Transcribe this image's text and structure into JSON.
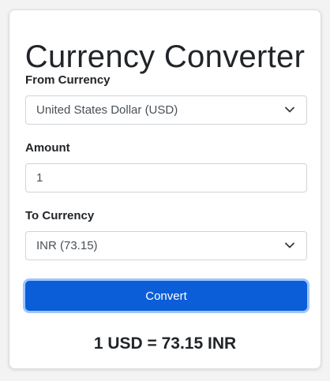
{
  "app": {
    "title": "Currency Converter"
  },
  "form": {
    "from_label": "From Currency",
    "from_value": "United States Dollar (USD)",
    "amount_label": "Amount",
    "amount_value": "1",
    "to_label": "To Currency",
    "to_value": "INR (73.15)",
    "convert_label": "Convert"
  },
  "result": {
    "text": "1 USD = 73.15 INR"
  },
  "colors": {
    "primary": "#0b5ed7",
    "focus_ring": "#9ec5fe",
    "text": "#212529",
    "field_border": "#ced4da"
  },
  "icons": {
    "from_dropdown": "chevron-down-icon",
    "to_dropdown": "chevron-down-icon"
  }
}
